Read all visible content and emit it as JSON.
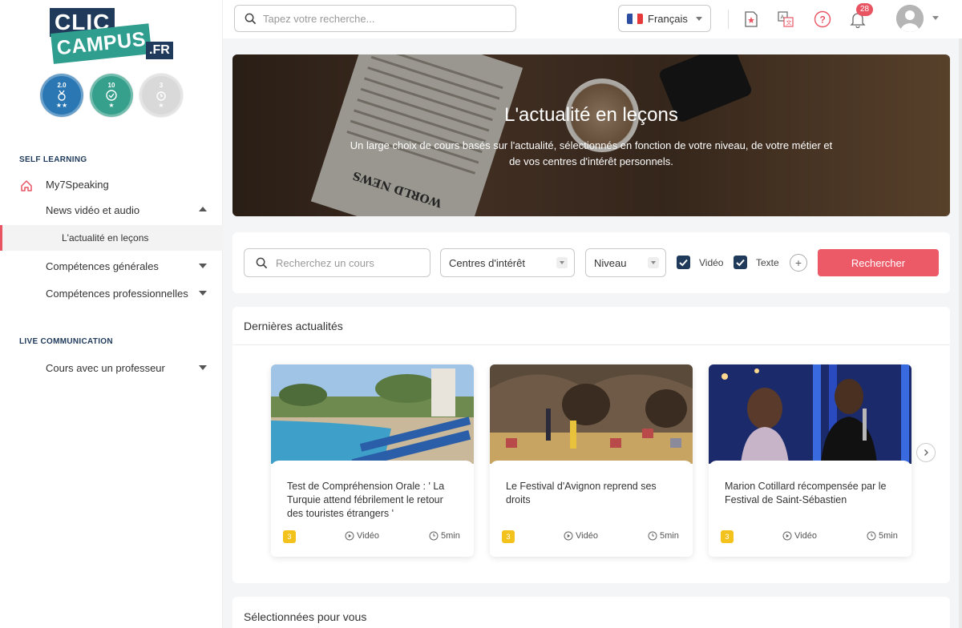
{
  "brand": {
    "logo_line1": "CLIC",
    "logo_line2": "CAMPUS",
    "logo_suffix": ".FR"
  },
  "badges": [
    {
      "label": "2.0",
      "icon": "medal-icon",
      "color": "#2a77b3"
    },
    {
      "label": "10",
      "icon": "check-badge-icon",
      "color": "#36a08c"
    },
    {
      "label": "3",
      "icon": "alarm-icon",
      "color": "#d9d9d9"
    }
  ],
  "sidebar": {
    "section1": "SELF LEARNING",
    "section2": "LIVE COMMUNICATION",
    "items": [
      {
        "label": "My7Speaking"
      },
      {
        "label": "News vidéo et audio"
      },
      {
        "label": "L'actualité en leçons"
      },
      {
        "label": "Compétences générales"
      },
      {
        "label": "Compétences professionnelles"
      },
      {
        "label": "Cours avec un professeur"
      }
    ]
  },
  "topbar": {
    "search_placeholder": "Tapez votre recherche...",
    "language": "Français",
    "notifications_count": "28"
  },
  "hero": {
    "title": "L'actualité en leçons",
    "subtitle": "Un large choix de cours basés sur l'actualité, sélectionnés en fonction de votre niveau, de votre métier et de vos centres d'intérêt personnels.",
    "paper_headline": "WORLD NEWS"
  },
  "filters": {
    "search_placeholder": "Recherchez un cours",
    "interests": "Centres d'intérêt",
    "level": "Niveau",
    "video_label": "Vidéo",
    "video_checked": true,
    "text_label": "Texte",
    "text_checked": true,
    "plus": "+",
    "search_button": "Rechercher"
  },
  "news": {
    "header": "Dernières actualités",
    "cards": [
      {
        "title": "Test de Compréhension Orale : ' La Turquie attend fébrilement le retour des touristes étrangers '",
        "level": "3",
        "type": "Vidéo",
        "duration": "5min"
      },
      {
        "title": "Le Festival d'Avignon reprend ses droits",
        "level": "3",
        "type": "Vidéo",
        "duration": "5min"
      },
      {
        "title": "Marion Cotillard récompensée par le Festival de Saint-Sébastien",
        "level": "3",
        "type": "Vidéo",
        "duration": "5min"
      }
    ]
  },
  "selected": {
    "header": "Sélectionnées pour vous"
  },
  "colors": {
    "accent": "#ec5a68",
    "navy": "#1f3a5a",
    "teal": "#2f9e8f",
    "level_badge": "#f3c21c"
  }
}
